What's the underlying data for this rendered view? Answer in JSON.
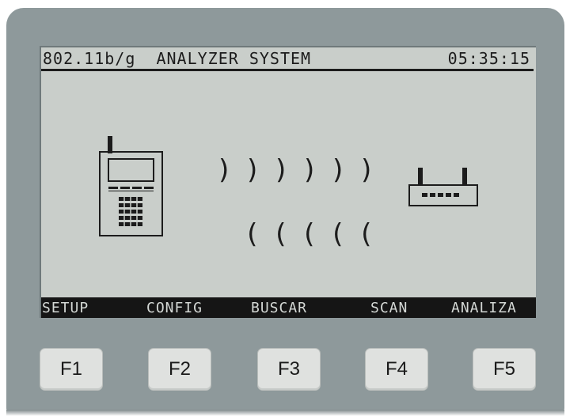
{
  "screen": {
    "title": "802.11b/g  ANALYZER SYSTEM",
    "clock": "05:35:15",
    "signal_right": [
      ")",
      ")",
      ")",
      ")",
      ")",
      ")"
    ],
    "signal_left": [
      "(",
      "(",
      "(",
      "(",
      "("
    ]
  },
  "softkeys": [
    "SETUP",
    "CONFIG",
    "BUSCAR",
    "SCAN",
    "ANALIZA"
  ],
  "function_keys": [
    "F1",
    "F2",
    "F3",
    "F4",
    "F5"
  ],
  "colors": {
    "bezel": "#8e999b",
    "lcd_background": "#c9ceca",
    "lcd_ink": "#1c1c1c",
    "softkey_bar": "#151515",
    "button": "#dfe1df"
  },
  "icons": [
    "handheld-analyzer-icon",
    "wireless-router-icon"
  ]
}
